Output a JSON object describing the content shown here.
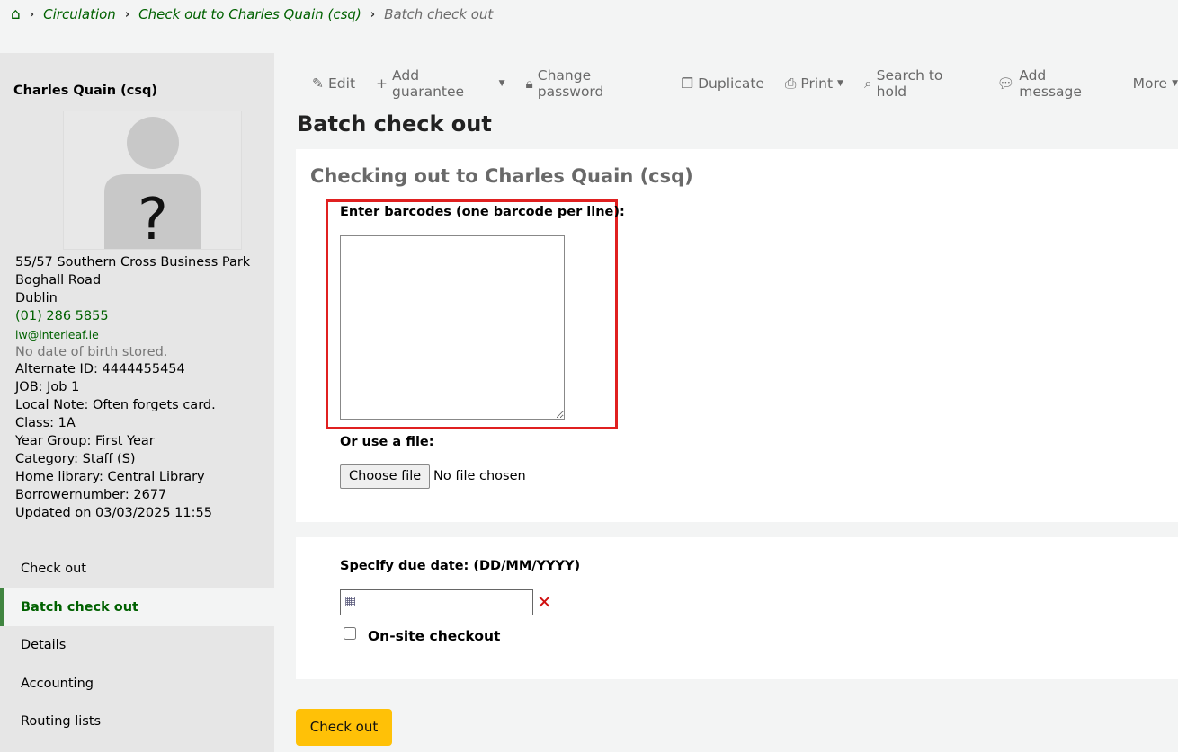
{
  "breadcrumb": {
    "home": "home",
    "items": [
      "Circulation",
      "Check out to Charles Quain (csq)"
    ],
    "current": "Batch check out"
  },
  "patron": {
    "name": "Charles Quain (csq)",
    "lines": [
      "55/57 Southern Cross Business Park",
      "Boghall Road",
      "Dublin"
    ],
    "phone": "(01) 286 5855",
    "email": "lw@interleaf.ie",
    "dob": "No date of birth stored.",
    "details": [
      "Alternate ID: 4444455454",
      "JOB: Job 1",
      "Local Note: Often forgets card.",
      "Class: 1A",
      "Year Group: First Year",
      "Category: Staff (S)",
      "Home library: Central Library",
      "Borrowernumber: 2677",
      "Updated on 03/03/2025 11:55"
    ]
  },
  "nav": [
    "Check out",
    "Batch check out",
    "Details",
    "Accounting",
    "Routing lists"
  ],
  "toolbar": {
    "edit": "Edit",
    "add_guarantee": "Add guarantee",
    "change_password": "Change password",
    "duplicate": "Duplicate",
    "print": "Print",
    "search_to_hold": "Search to hold",
    "add_message": "Add message",
    "more": "More"
  },
  "page": {
    "title": "Batch check out",
    "subtitle": "Checking out to Charles Quain (csq)",
    "barcodes_label": "Enter barcodes (one barcode per line):",
    "file_label": "Or use a file:",
    "choose_file": "Choose file",
    "no_file": "No file chosen",
    "due_label": "Specify due date: (DD/MM/YYYY)",
    "onsite": "On-site checkout",
    "submit": "Check out"
  }
}
